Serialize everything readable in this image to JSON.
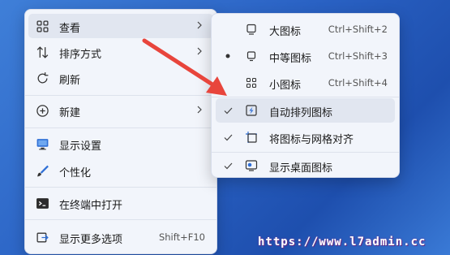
{
  "main_menu": {
    "items": [
      {
        "label": "查看",
        "icon": "grid-icon",
        "has_submenu": true
      },
      {
        "label": "排序方式",
        "icon": "sort-icon",
        "has_submenu": true
      },
      {
        "label": "刷新",
        "icon": "refresh-icon"
      },
      {
        "label": "新建",
        "icon": "add-icon",
        "has_submenu": true
      },
      {
        "label": "显示设置",
        "icon": "display-icon"
      },
      {
        "label": "个性化",
        "icon": "brush-icon"
      },
      {
        "label": "在终端中打开",
        "icon": "terminal-icon"
      },
      {
        "label": "显示更多选项",
        "icon": "more-options-icon",
        "shortcut": "Shift+F10"
      }
    ]
  },
  "view_submenu": {
    "items": [
      {
        "label": "大图标",
        "icon": "large-icons-icon",
        "shortcut": "Ctrl+Shift+2",
        "mark": ""
      },
      {
        "label": "中等图标",
        "icon": "medium-icons-icon",
        "shortcut": "Ctrl+Shift+3",
        "mark": "dot"
      },
      {
        "label": "小图标",
        "icon": "small-icons-icon",
        "shortcut": "Ctrl+Shift+4",
        "mark": ""
      },
      {
        "label": "自动排列图标",
        "icon": "auto-arrange-icon",
        "mark": "check"
      },
      {
        "label": "将图标与网格对齐",
        "icon": "align-grid-icon",
        "mark": "check"
      },
      {
        "label": "显示桌面图标",
        "icon": "show-desktop-icon",
        "mark": "check"
      }
    ]
  },
  "watermark": "https://www.l7admin.cc",
  "colors": {
    "accent": "#2f6fd6",
    "arrow": "#e8453c",
    "menu_bg": "#f2f5fb"
  }
}
